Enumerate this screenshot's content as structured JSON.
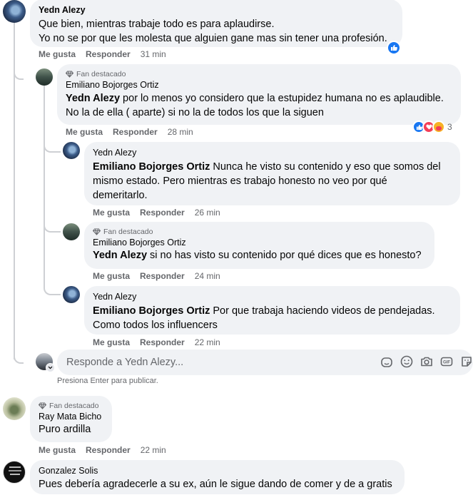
{
  "comments": [
    {
      "author": "Yedn Alezy",
      "line1": "Que bien, mientras trabaje todo es para aplaudirse.",
      "line2": "Yo no se por que les molesta que alguien gane mas sin tener una profesión.",
      "like": "Me gusta",
      "reply": "Responder",
      "time": "31 min"
    },
    {
      "badge": "Fan destacado",
      "author": "Emiliano Bojorges Ortiz",
      "mention": "Yedn Alezy",
      "line1": " por lo menos yo considero que la estupidez humana no es aplaudible.",
      "line2": "No la de ella ( aparte) si no la de todos los que la siguen",
      "like": "Me gusta",
      "reply": "Responder",
      "time": "28 min",
      "reaction_count": "3"
    },
    {
      "author": "Yedn Alezy",
      "mention": "Emiliano Bojorges Ortiz",
      "line1": " Nunca he visto su contenido y eso que somos del",
      "line2": "mismo estado. Pero mientras es trabajo honesto no veo por qué",
      "line3": "demeritarlo.",
      "like": "Me gusta",
      "reply": "Responder",
      "time": "26 min"
    },
    {
      "badge": "Fan destacado",
      "author": "Emiliano Bojorges Ortiz",
      "mention": "Yedn Alezy",
      "line1": " si no has visto su contenido por qué dices que es honesto?",
      "like": "Me gusta",
      "reply": "Responder",
      "time": "24 min"
    },
    {
      "author": "Yedn Alezy",
      "mention": "Emiliano Bojorges Ortiz",
      "line1": " Por que trabaja haciendo videos de pendejadas.",
      "line2": "Como todos los influencers",
      "like": "Me gusta",
      "reply": "Responder",
      "time": "22 min"
    },
    {
      "badge": "Fan destacado",
      "author": "Ray Mata Bicho",
      "line1": "Puro ardilla",
      "like": "Me gusta",
      "reply": "Responder",
      "time": "22 min"
    },
    {
      "author": "Gonzalez Solis",
      "line1": "Pues debería agradecerle a su ex, aún le sigue dando de comer y de a gratis"
    }
  ],
  "reply_box": {
    "placeholder": "Responde a Yedn Alezy...",
    "hint": "Presiona Enter para publicar."
  },
  "colors": {
    "bubble": "#f0f2f5",
    "secondary_text": "#65676b",
    "like_blue": "#1877f2",
    "love_red": "#f33e58",
    "thread_line": "#ced0d4"
  }
}
